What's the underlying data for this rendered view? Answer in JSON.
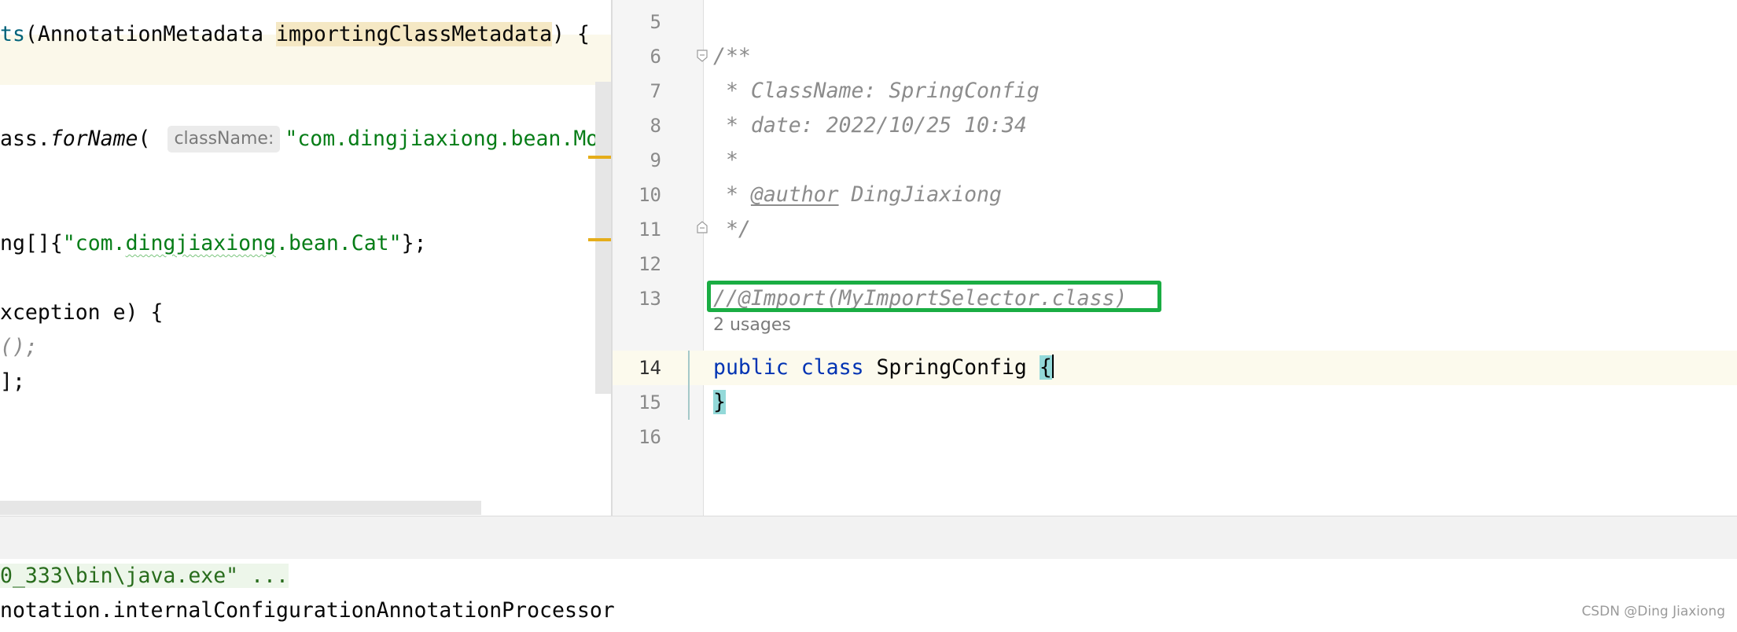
{
  "left_editor": {
    "line1": {
      "method_tail": "ts",
      "open": "(",
      "type": "AnnotationMetadata ",
      "param": "importingClassMetadata",
      "close": ") {"
    },
    "line2": {
      "prefix": "ass.",
      "method": "forName",
      "open": "( ",
      "hint": "className:",
      "string": "\"com.dingjiaxiong.bean.Mous"
    },
    "line3": {
      "prefix": "ng[]{",
      "string_q1": "\"com.",
      "string_squiggle": "dingjiaxiong",
      "string_rest": ".bean.Cat\"",
      "suffix": "};"
    },
    "line4": "xception e) {",
    "line5": "();",
    "line6": "];"
  },
  "right_editor": {
    "line_numbers": [
      "5",
      "6",
      "7",
      "8",
      "9",
      "10",
      "11",
      "12",
      "13",
      "14",
      "15",
      "16"
    ],
    "doc_open": "/**",
    "doc_classname": " * ClassName: SpringConfig",
    "doc_date": " * date: 2022/10/25 10:34",
    "doc_star": " *",
    "doc_author_prefix": " * ",
    "doc_author_tag": "@author",
    "doc_author_name": " DingJiaxiong",
    "doc_close": " */",
    "commented_import": "//@Import(MyImportSelector.class)",
    "usages": "2 usages",
    "class_kw_public": "public",
    "class_kw_class": "class",
    "class_name": " SpringConfig ",
    "open_brace": "{",
    "close_brace": "}",
    "highlight_color": "#1aad43"
  },
  "console": {
    "line1": "0_333\\bin\\java.exe\" ...",
    "line2": "notation.internalConfigurationAnnotationProcessor"
  },
  "watermark": "CSDN @Ding Jiaxiong"
}
